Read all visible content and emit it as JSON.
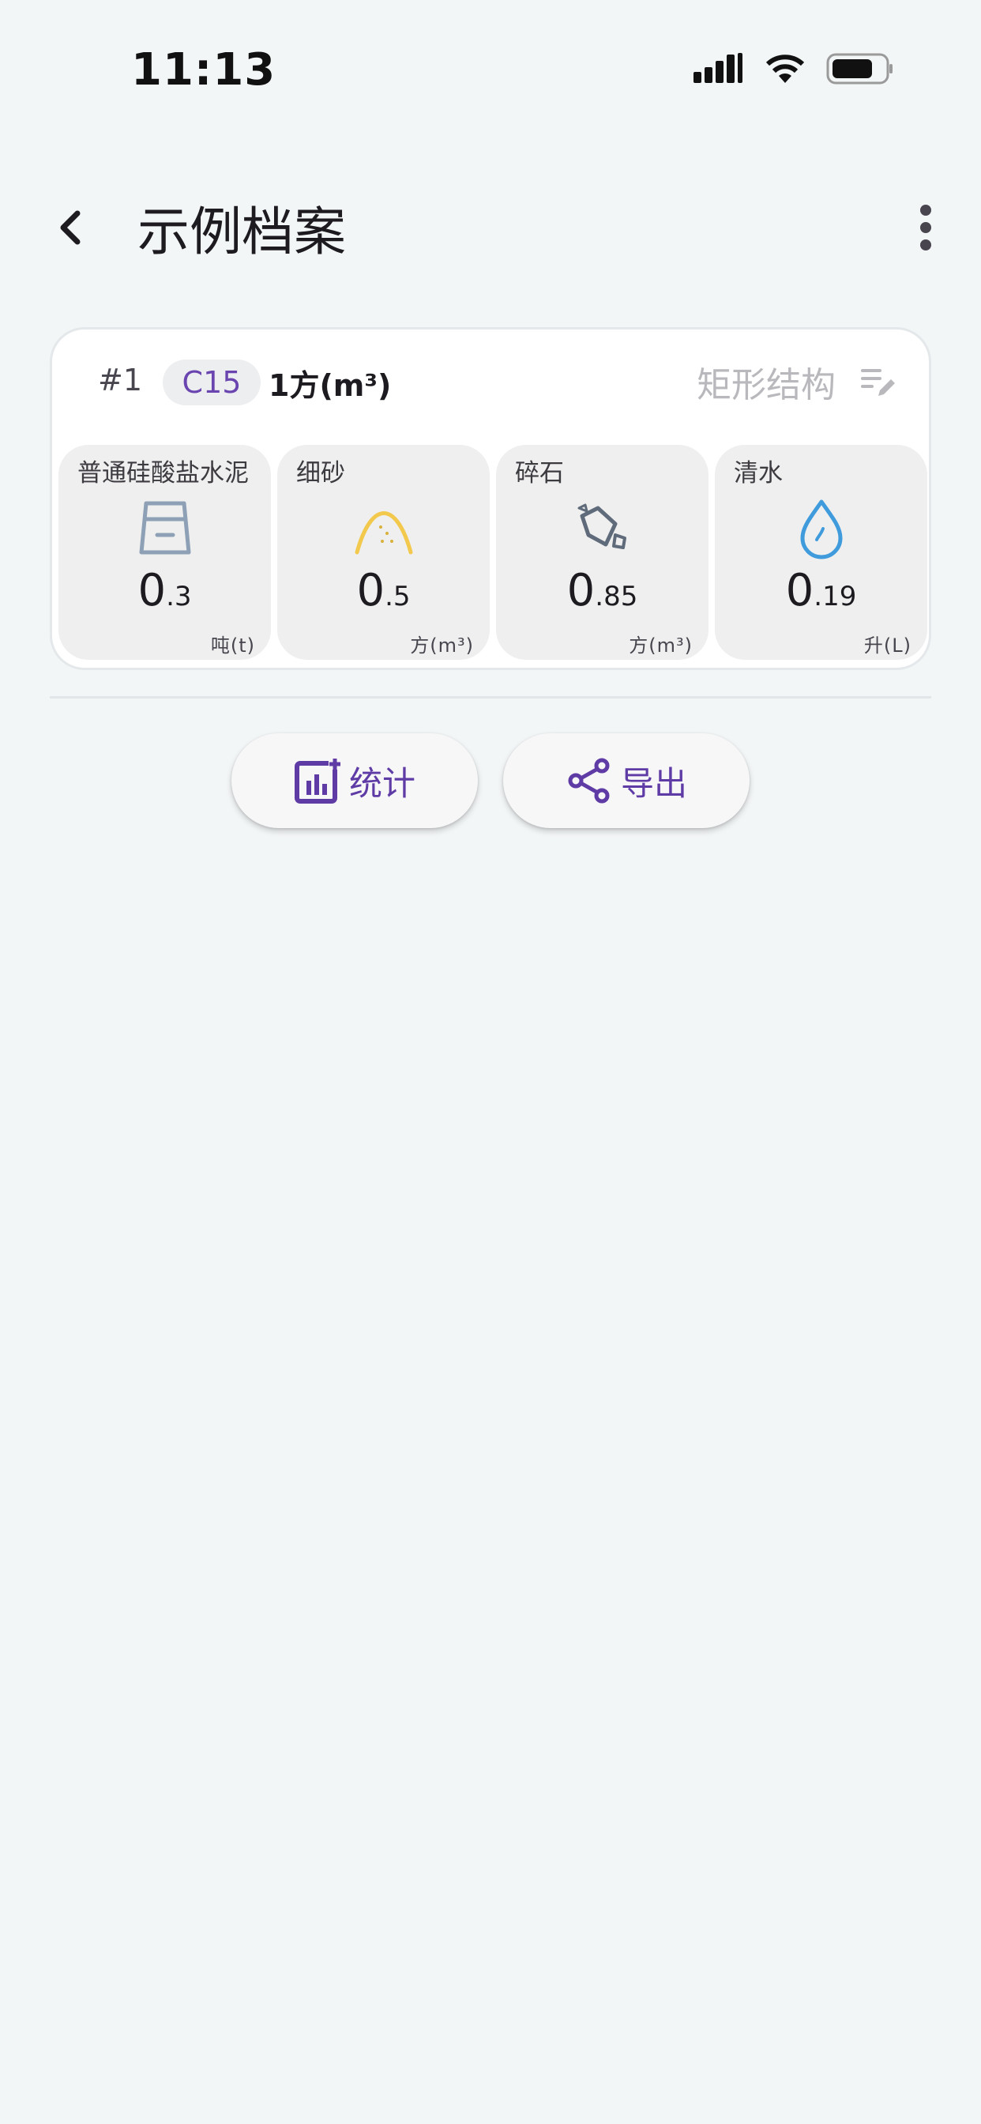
{
  "status_bar": {
    "time": "11:13"
  },
  "app_bar": {
    "title": "示例档案"
  },
  "record": {
    "id": "#1",
    "grade": "C15",
    "volume": "1方(m³)",
    "structure": "矩形结构"
  },
  "materials": [
    {
      "name": "普通硅酸盐水泥",
      "value_int": "0",
      "value_dec": ".3",
      "unit": "吨(t)",
      "icon": "cement-container-icon",
      "color": "#8da0b5"
    },
    {
      "name": "细砂",
      "value_int": "0",
      "value_dec": ".5",
      "unit": "方(m³)",
      "icon": "sand-pile-icon",
      "color": "#f2c94c"
    },
    {
      "name": "碎石",
      "value_int": "0",
      "value_dec": ".85",
      "unit": "方(m³)",
      "icon": "gravel-stone-icon",
      "color": "#5f6a7a"
    },
    {
      "name": "清水",
      "value_int": "0",
      "value_dec": ".19",
      "unit": "升(L)",
      "icon": "water-drop-icon",
      "color": "#3f9bdc"
    }
  ],
  "actions": {
    "stats_label": "统计",
    "export_label": "导出"
  },
  "colors": {
    "accent": "#5f3ba6",
    "background": "#f3f6f7",
    "card": "#ffffff"
  }
}
